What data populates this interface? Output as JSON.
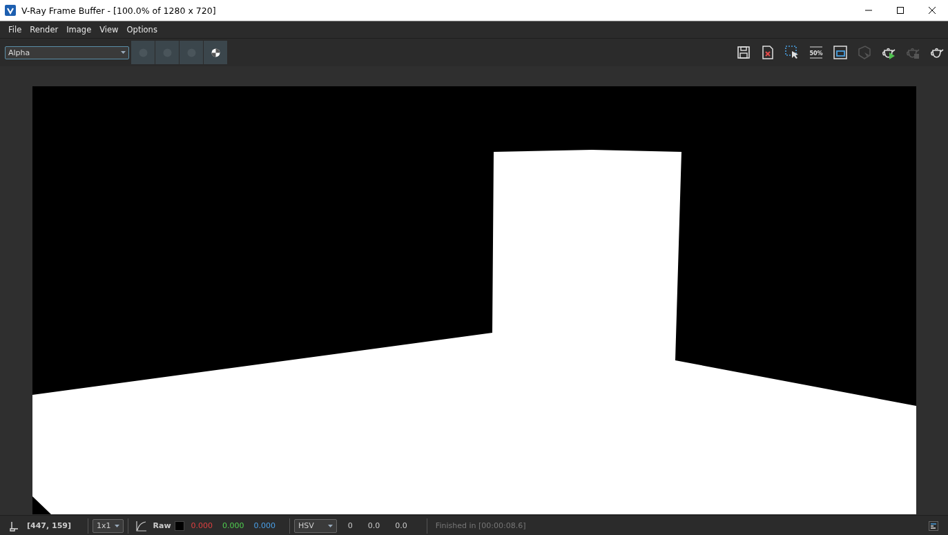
{
  "window": {
    "title": "V-Ray Frame Buffer - [100.0% of 1280 x 720]"
  },
  "menu": [
    "File",
    "Render",
    "Image",
    "View",
    "Options"
  ],
  "toolbar": {
    "channel": "Alpha",
    "channel_buttons": [
      {
        "disabled": true
      },
      {
        "disabled": true
      },
      {
        "disabled": true
      },
      {
        "disabled": false
      }
    ],
    "tools": [
      {
        "kind": "save",
        "disabled": false
      },
      {
        "kind": "clear",
        "disabled": false
      },
      {
        "kind": "region",
        "disabled": false
      },
      {
        "kind": "zoom",
        "disabled": false,
        "label": "50%"
      },
      {
        "kind": "compare",
        "disabled": false
      },
      {
        "kind": "lens",
        "disabled": true
      },
      {
        "kind": "render",
        "disabled": false
      },
      {
        "kind": "stop",
        "disabled": true
      },
      {
        "kind": "teapot",
        "disabled": false
      }
    ]
  },
  "status_bar": {
    "coords": "[447, 159]",
    "sampling": "1x1",
    "mode": "Raw",
    "rgb": [
      {
        "value": "0.000",
        "color": "#e04040"
      },
      {
        "value": "0.000",
        "color": "#50d050"
      },
      {
        "value": "0.000",
        "color": "#4aa0e8"
      }
    ],
    "color_space": "HSV",
    "hsv": [
      "0",
      "0.0",
      "0.0"
    ],
    "message": "Finished in [00:00:08.6]"
  }
}
